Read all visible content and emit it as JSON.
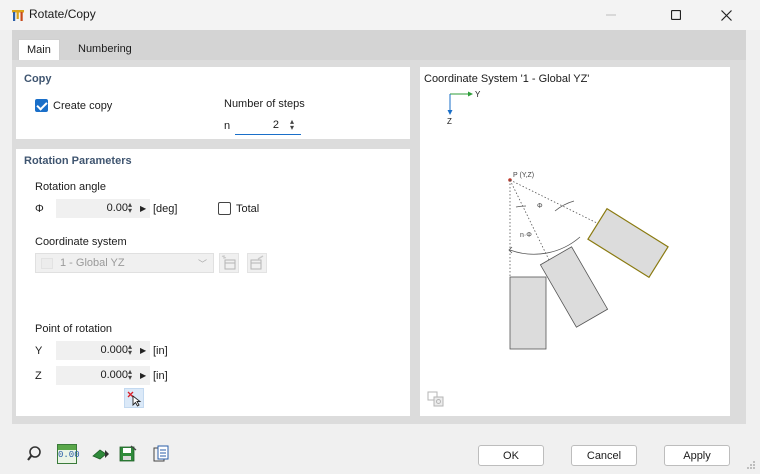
{
  "window": {
    "title": "Rotate/Copy"
  },
  "tabs": [
    {
      "label": "Main",
      "active": true
    },
    {
      "label": "Numbering",
      "active": false
    }
  ],
  "copy": {
    "heading": "Copy",
    "create_copy_label": "Create copy",
    "create_copy_checked": true,
    "steps_label": "Number of steps",
    "n_symbol": "n",
    "n_value": "2"
  },
  "rotation": {
    "heading": "Rotation Parameters",
    "angle_label": "Rotation angle",
    "phi_symbol": "Φ",
    "angle_value": "0.00",
    "angle_unit": "[deg]",
    "total_label": "Total",
    "total_checked": false,
    "coord_label": "Coordinate system",
    "coord_value": "1 - Global YZ",
    "point_label": "Point of rotation",
    "y_symbol": "Y",
    "y_value": "0.000",
    "y_unit": "[in]",
    "z_symbol": "Z",
    "z_value": "0.000",
    "z_unit": "[in]"
  },
  "preview": {
    "title": "Coordinate System '1 - Global YZ'",
    "axis_y": "Y",
    "axis_z": "Z",
    "point_label": "P (Y,Z)",
    "phi_label": "Φ",
    "nphi_label": "n·Φ"
  },
  "footer": {
    "ok_label": "OK",
    "cancel_label": "Cancel",
    "apply_label": "Apply",
    "units_icon_text": "0.00"
  },
  "colors": {
    "accent": "#1a6fc9",
    "heading": "#3f5570",
    "shape_fill": "#dcdcdc",
    "rotated_outline": "#8a7a10"
  }
}
